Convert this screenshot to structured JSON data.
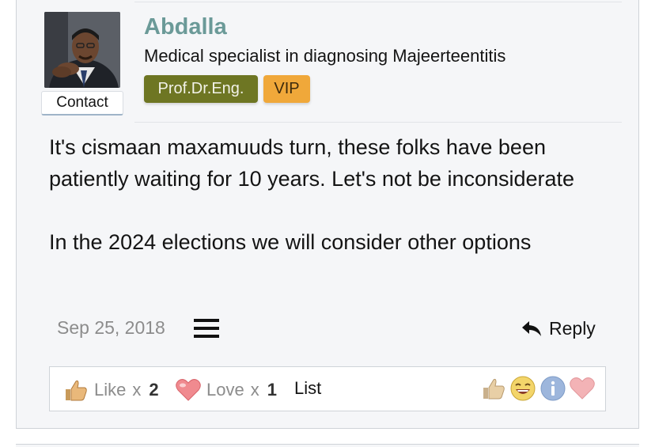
{
  "author": {
    "name": "Abdalla",
    "title": "Medical specialist in diagnosing Majeerteentitis",
    "contact_label": "Contact",
    "badges": [
      "Prof.Dr.Eng.",
      "VIP"
    ]
  },
  "post": {
    "paragraphs": [
      "It's cismaan maxamuuds turn, these folks have been patiently waiting for 10 years. Let's not be inconsiderate",
      "In the 2024 elections we will consider other options"
    ],
    "date": "Sep 25, 2018",
    "reply_label": "Reply"
  },
  "reactions": {
    "like_label": "Like",
    "like_mult": "x",
    "like_count": "2",
    "love_label": "Love",
    "love_mult": "x",
    "love_count": "1",
    "list_label": "List",
    "picker_icons": [
      "thumbs-up-icon",
      "laugh-icon",
      "info-icon",
      "heart-icon"
    ]
  },
  "colors": {
    "username": "#6b9a98",
    "badge_prof": "#6e7623",
    "badge_vip": "#f0a83a"
  }
}
